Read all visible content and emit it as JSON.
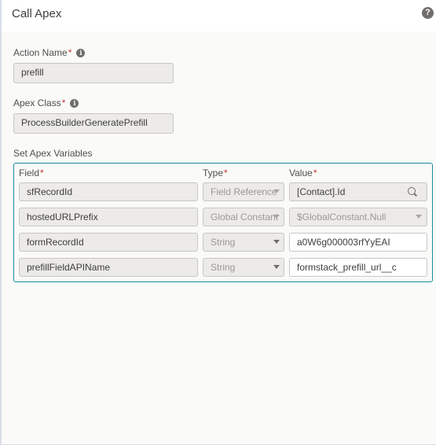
{
  "header": {
    "title": "Call Apex",
    "help_icon": "question-circle-icon"
  },
  "action_name": {
    "label": "Action Name",
    "required": "*",
    "value": "prefill",
    "info_icon": "info-icon"
  },
  "apex_class": {
    "label": "Apex Class",
    "required": "*",
    "value": "ProcessBuilderGeneratePrefill",
    "info_icon": "info-icon"
  },
  "variables": {
    "section_label": "Set Apex Variables",
    "columns": {
      "field": "Field",
      "type": "Type",
      "value": "Value",
      "required": "*"
    },
    "rows": [
      {
        "field": "sfRecordId",
        "type": "Field Reference",
        "value": "[Contact].Id"
      },
      {
        "field": "hostedURLPrefix",
        "type": "Global Constant",
        "value": "$GlobalConstant.Null"
      },
      {
        "field": "formRecordId",
        "type": "String",
        "value": "a0W6g000003rfYyEAI"
      },
      {
        "field": "prefillFieldAPIName",
        "type": "String",
        "value": "formstack_prefill_url__c"
      }
    ]
  },
  "colors": {
    "accent_border": "#1b8a9e",
    "required": "#c23934"
  }
}
